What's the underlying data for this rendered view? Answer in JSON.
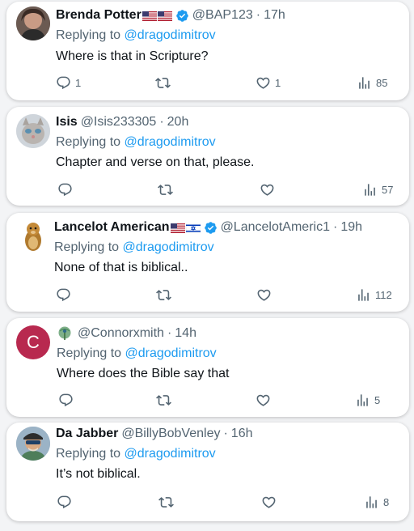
{
  "tweets": [
    {
      "name": "Brenda Potter",
      "handle": "@BAP123",
      "sep": "·",
      "time": "17h",
      "replying_prefix": "Replying to ",
      "replying_to": "@dragodimitrov",
      "text": "Where is that in Scripture?",
      "reply_count": "1",
      "retweet_count": "",
      "like_count": "1",
      "view_count": "85",
      "verified": true,
      "flags": [
        "us-flag",
        "us-flag"
      ]
    },
    {
      "name": "Isis",
      "handle": "@Isis233305",
      "sep": "·",
      "time": "20h",
      "replying_prefix": "Replying to ",
      "replying_to": "@dragodimitrov",
      "text": "Chapter and verse on that, please.",
      "reply_count": "",
      "retweet_count": "",
      "like_count": "",
      "view_count": "57",
      "verified": false,
      "flags": []
    },
    {
      "name": "Lancelot American",
      "handle": "@LancelotAmeric1",
      "sep": "·",
      "time": "19h",
      "replying_prefix": "Replying to ",
      "replying_to": "@dragodimitrov",
      "text": "None of that is biblical..",
      "reply_count": "",
      "retweet_count": "",
      "like_count": "",
      "view_count": "112",
      "verified": true,
      "flags": [
        "us-flag",
        "israel-flag"
      ]
    },
    {
      "name": "",
      "handle": "@Connorxmith",
      "sep": "·",
      "time": "14h",
      "replying_prefix": "Replying to ",
      "replying_to": "@dragodimitrov",
      "text": "Where does the Bible say that",
      "reply_count": "",
      "retweet_count": "",
      "like_count": "",
      "view_count": "5",
      "verified": false,
      "flags": [],
      "avatar_letter": "C"
    },
    {
      "name": "Da Jabber",
      "handle": "@BillyBobVenley",
      "sep": "·",
      "time": "16h",
      "replying_prefix": "Replying to ",
      "replying_to": "@dragodimitrov",
      "text": "It’s not biblical.",
      "reply_count": "",
      "retweet_count": "",
      "like_count": "",
      "view_count": "8",
      "verified": false,
      "flags": []
    }
  ],
  "colors": {
    "accent": "#1d9bf0",
    "text": "#0f1419",
    "muted": "#536471",
    "avatar_c": "#b8294f"
  },
  "icons": [
    "reply-icon",
    "retweet-icon",
    "like-icon",
    "views-icon",
    "verified-badge-icon",
    "peacock-icon"
  ]
}
